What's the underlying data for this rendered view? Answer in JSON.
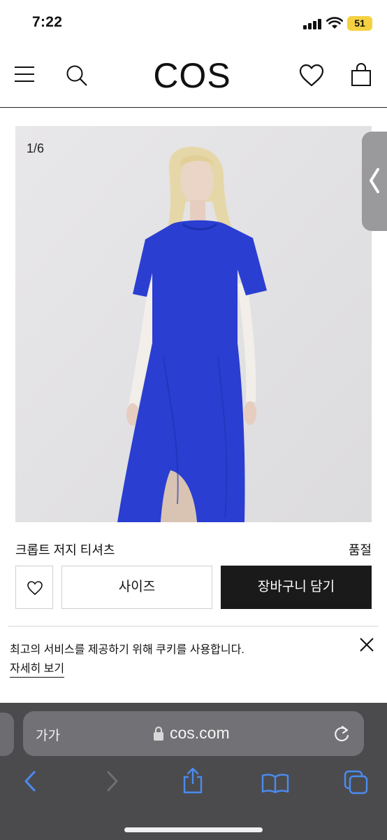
{
  "status_bar": {
    "time": "7:22",
    "battery": "51"
  },
  "header": {
    "logo": "COS"
  },
  "gallery": {
    "counter": "1/6"
  },
  "product": {
    "name": "크롭트 저지 티셔츠",
    "stock_status": "품절",
    "size_label": "사이즈",
    "cart_label": "장바구니 담기"
  },
  "cookie": {
    "message": "최고의 서비스를 제공하기 위해 쿠키를 사용합니다.",
    "link": "자세히 보기"
  },
  "browser": {
    "text_size": "가가",
    "url": "cos.com"
  },
  "colors": {
    "accent_dark": "#1a1a1a",
    "garment_blue": "#2c3fcf",
    "browser_chrome": "#4b4b4e",
    "toolbar_icon": "#4a8cf0",
    "battery": "#f5d142"
  }
}
